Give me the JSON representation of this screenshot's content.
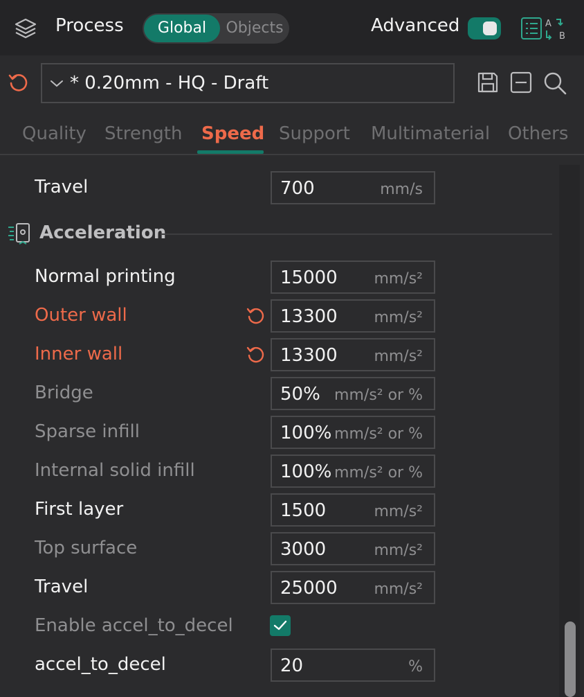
{
  "header": {
    "title": "Process",
    "segment": {
      "global": "Global",
      "objects": "Objects",
      "selected": "Global"
    },
    "advanced_label": "Advanced",
    "advanced_on": true,
    "icons": [
      "layers-icon",
      "compare-icon"
    ]
  },
  "preset": {
    "name": "* 0.20mm - HQ - Draft",
    "icons": [
      "reset-icon",
      "chevron-down-icon",
      "save-icon",
      "minus-icon",
      "search-icon"
    ]
  },
  "tabs": [
    {
      "label": "Quality"
    },
    {
      "label": "Strength"
    },
    {
      "label": "Speed",
      "active": true
    },
    {
      "label": "Support"
    },
    {
      "label": "Multimaterial"
    },
    {
      "label": "Others"
    }
  ],
  "speed_travel": {
    "label": "Travel",
    "value": "700",
    "unit": "mm/s"
  },
  "acceleration": {
    "title": "Acceleration",
    "rows": [
      {
        "label": "Normal printing",
        "value": "15000",
        "unit": "mm/s²",
        "state": "strong"
      },
      {
        "label": "Outer wall",
        "value": "13300",
        "unit": "mm/s²",
        "state": "modified"
      },
      {
        "label": "Inner wall",
        "value": "13300",
        "unit": "mm/s²",
        "state": "modified"
      },
      {
        "label": "Bridge",
        "value": "50%",
        "unit": "mm/s² or %",
        "state": "dim"
      },
      {
        "label": "Sparse infill",
        "value": "100%",
        "unit": "mm/s² or %",
        "state": "dim"
      },
      {
        "label": "Internal solid infill",
        "value": "100%",
        "unit": "mm/s² or %",
        "state": "dim"
      },
      {
        "label": "First layer",
        "value": "1500",
        "unit": "mm/s²",
        "state": "strong"
      },
      {
        "label": "Top surface",
        "value": "3000",
        "unit": "mm/s²",
        "state": "dim"
      },
      {
        "label": "Travel",
        "value": "25000",
        "unit": "mm/s²",
        "state": "strong"
      }
    ],
    "enable_accel_to_decel": {
      "label": "Enable accel_to_decel",
      "checked": true
    },
    "accel_to_decel": {
      "label": "accel_to_decel",
      "value": "20",
      "unit": "%"
    }
  },
  "colors": {
    "accent_green": "#137a68",
    "modified_orange": "#ee6a4a",
    "background": "#2b2b2d"
  }
}
